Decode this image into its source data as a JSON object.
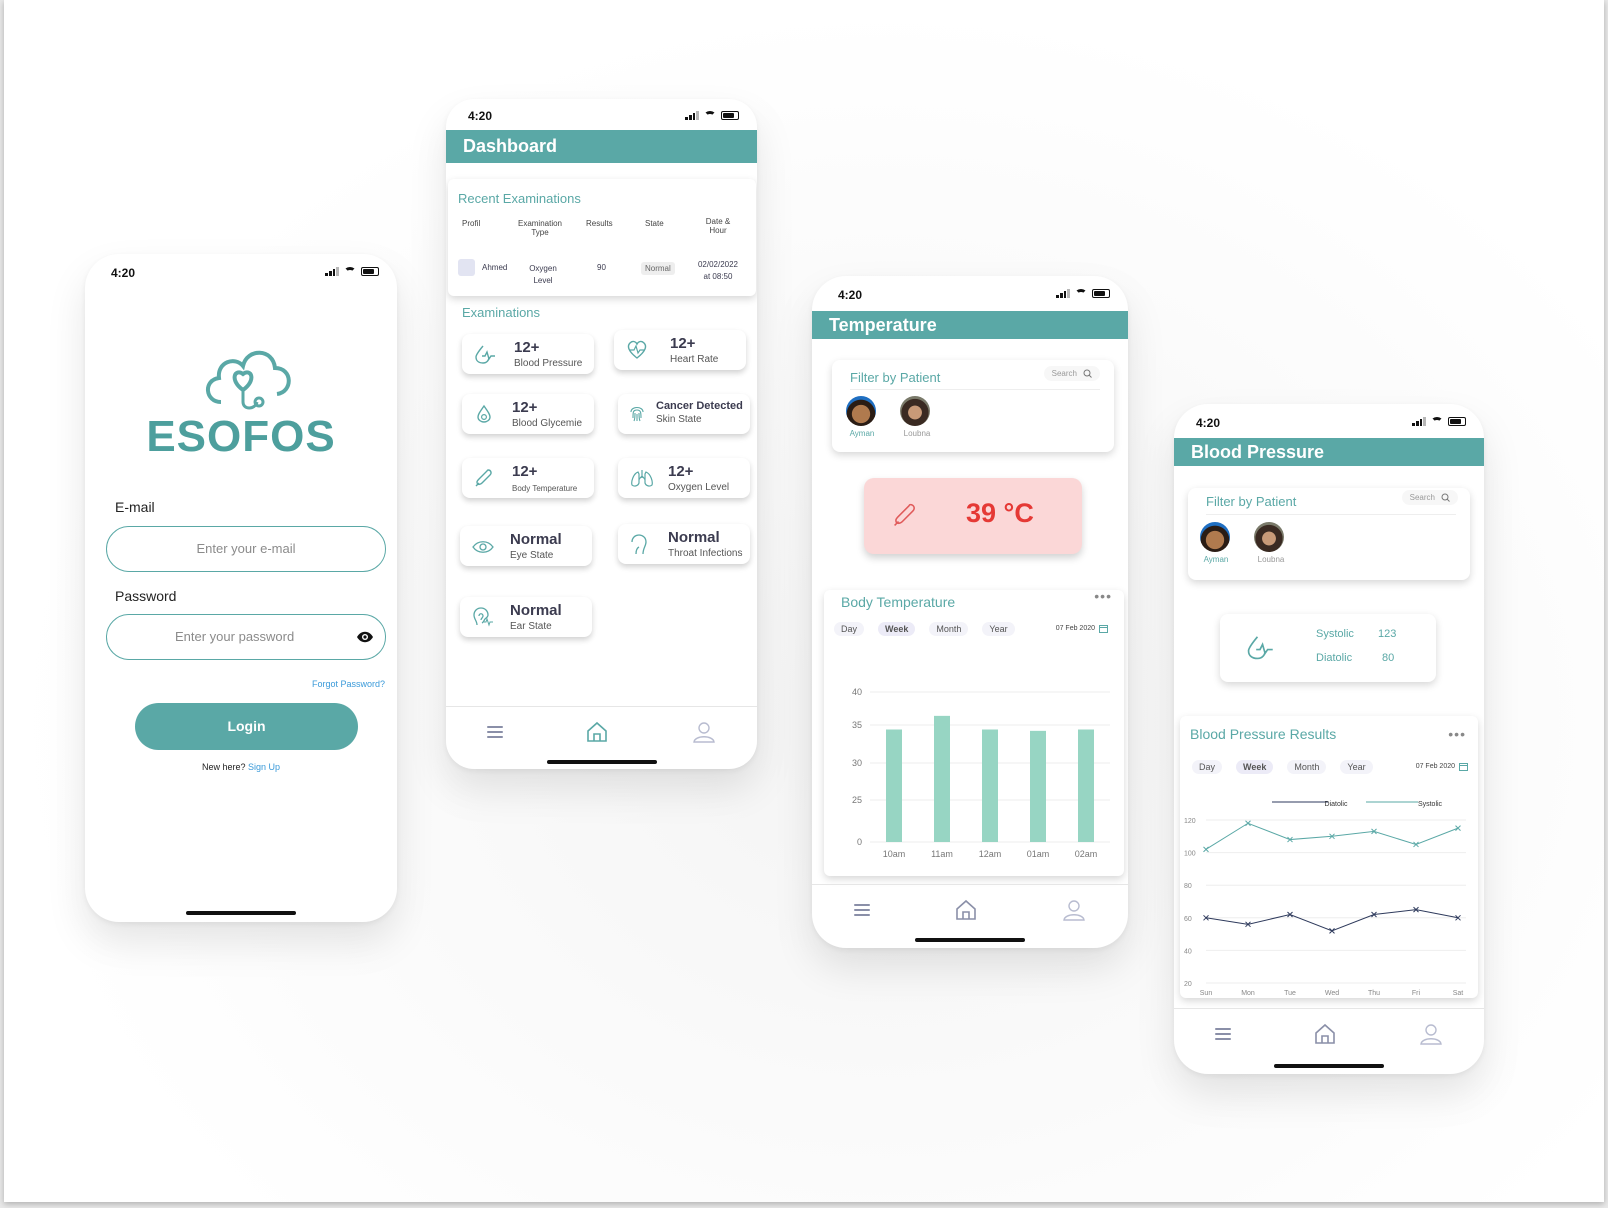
{
  "status": {
    "time": "4:20"
  },
  "login": {
    "logo_text": "ESOFOS",
    "email_label": "E-mail",
    "email_placeholder": "Enter your e-mail",
    "password_label": "Password",
    "password_placeholder": "Enter your password",
    "forgot": "Forgot Password?",
    "login_button": "Login",
    "new_here": "New here?",
    "sign_up": "Sign Up"
  },
  "dashboard": {
    "title": "Dashboard",
    "recent_title": "Recent Examinations",
    "columns": [
      "Profil",
      "Examination Type",
      "Results",
      "State",
      "Date & Hour"
    ],
    "row": {
      "name": "Ahmed",
      "type": "Oxygen Level",
      "result": "90",
      "state": "Normal",
      "date": "02/02/2022",
      "hour": "at 08:50"
    },
    "exams_title": "Examinations",
    "tiles": [
      {
        "icon": "blood-pressure-icon",
        "value": "12+",
        "label": "Blood Pressure"
      },
      {
        "icon": "heart-rate-icon",
        "value": "12+",
        "label": "Heart Rate"
      },
      {
        "icon": "blood-glycemie-icon",
        "value": "12+",
        "label": "Blood Glycemie"
      },
      {
        "icon": "fingerprint-icon",
        "value": "Cancer Detected",
        "label": "Skin  State"
      },
      {
        "icon": "thermometer-icon",
        "value": "12+",
        "label": "Body Temperature"
      },
      {
        "icon": "lungs-icon",
        "value": "12+",
        "label": "Oxygen Level"
      },
      {
        "icon": "eye-icon",
        "value": "Normal",
        "label": "Eye State"
      },
      {
        "icon": "throat-icon",
        "value": "Normal",
        "label": "Throat Infections"
      },
      {
        "icon": "ear-icon",
        "value": "Normal",
        "label": "Ear State"
      }
    ]
  },
  "temperature": {
    "title": "Temperature",
    "filter_title": "Filter by Patient",
    "search": "Search",
    "patients": [
      "Ayman",
      "Loubna"
    ],
    "reading": "39 °C",
    "chart_title": "Body Temperature",
    "tabs": [
      "Day",
      "Week",
      "Month",
      "Year"
    ],
    "date": "07 Feb 2020"
  },
  "blood_pressure": {
    "title": "Blood Pressure",
    "filter_title": "Filter by Patient",
    "search": "Search",
    "patients": [
      "Ayman",
      "Loubna"
    ],
    "systolic_label": "Systolic",
    "systolic_value": "123",
    "diatolic_label": "Diatolic",
    "diatolic_value": "80",
    "chart_title": "Blood Pressure Results",
    "tabs": [
      "Day",
      "Week",
      "Month",
      "Year"
    ],
    "date": "07 Feb 2020"
  },
  "colors": {
    "accent": "#5aa8a6",
    "bar": "#97d5c3",
    "alert_bg": "#fbd7d7",
    "alert_text": "#e53935",
    "line_dark": "#2e3a5c"
  },
  "chart_data": [
    {
      "type": "bar",
      "title": "Body Temperature",
      "categories": [
        "10am",
        "11am",
        "12am",
        "01am",
        "02am"
      ],
      "values": [
        36.5,
        38.5,
        36.5,
        36.3,
        36.5
      ],
      "yticks": [
        "0",
        "25",
        "30",
        "35",
        "40"
      ],
      "ylim": [
        20,
        42
      ]
    },
    {
      "type": "line",
      "title": "Blood Pressure Results",
      "categories": [
        "Sun",
        "Mon",
        "Tue",
        "Wed",
        "Thu",
        "Fri",
        "Sat"
      ],
      "series": [
        {
          "name": "Systolic",
          "values": [
            102,
            118,
            108,
            110,
            113,
            105,
            115
          ]
        },
        {
          "name": "Diatolic",
          "values": [
            60,
            56,
            62,
            52,
            62,
            65,
            60
          ]
        }
      ],
      "yticks": [
        "20",
        "40",
        "60",
        "80",
        "100",
        "120"
      ],
      "ylim": [
        20,
        120
      ]
    }
  ]
}
